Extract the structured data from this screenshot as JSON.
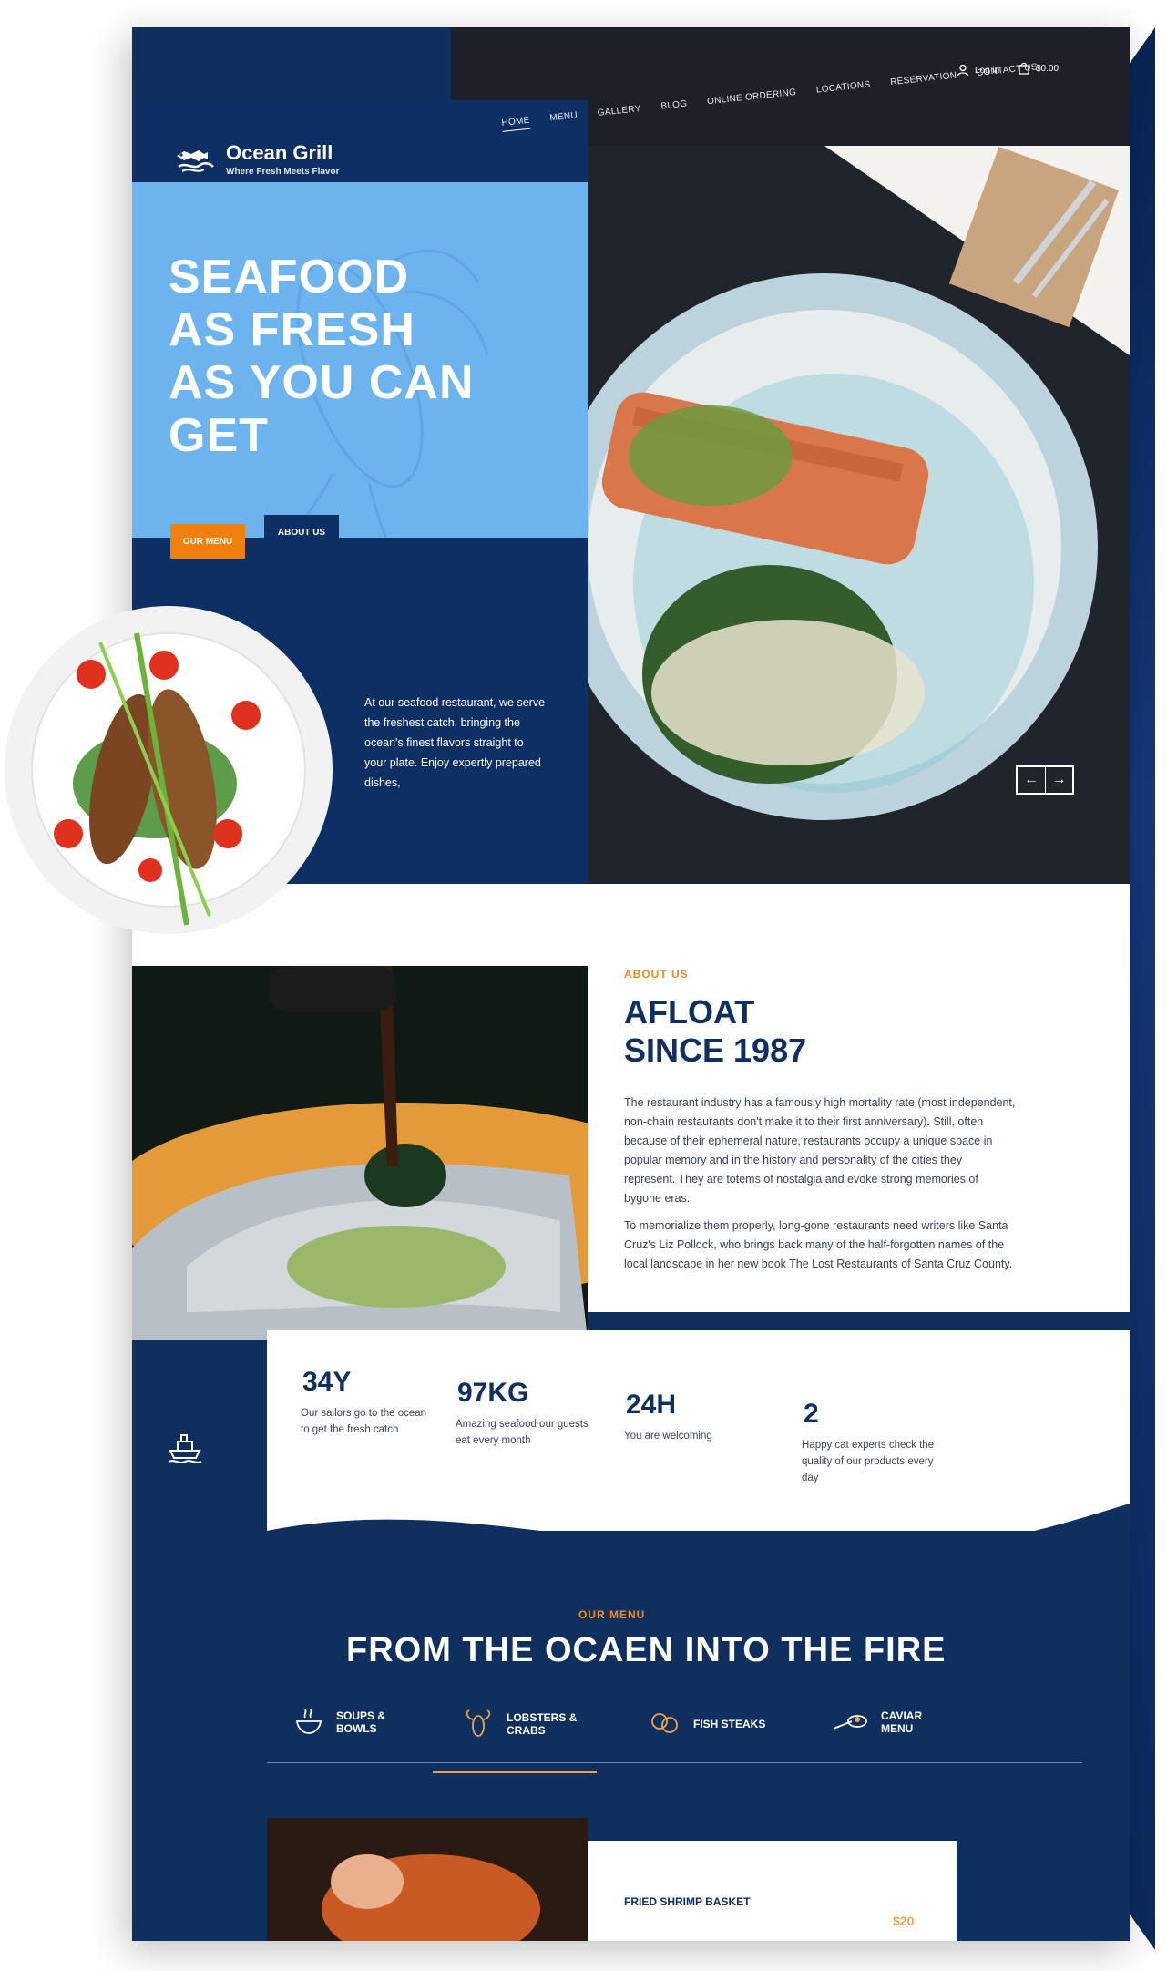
{
  "brand": {
    "name": "Ocean Grill",
    "tagline": "Where Fresh Meets Flavor"
  },
  "nav": {
    "items": [
      "HOME",
      "MENU",
      "GALLERY",
      "BLOG",
      "ONLINE ORDERING",
      "LOCATIONS",
      "RESERVATION",
      "CONTACT US"
    ],
    "login": "Log in",
    "cart": "$0.00"
  },
  "hero": {
    "title_lines": [
      "SEAFOOD",
      "AS FRESH",
      "AS YOU CAN",
      "GET"
    ],
    "btn_menu": "OUR MENU",
    "btn_about": "ABOUT US",
    "text": "At our seafood restaurant, we serve the freshest catch, bringing the ocean's finest flavors straight to your plate. Enjoy expertly prepared dishes,"
  },
  "about": {
    "eyebrow": "ABOUT US",
    "title_lines": [
      "AFLOAT",
      "SINCE 1987"
    ],
    "p1": "The restaurant industry has a famously high mortality rate (most independent, non-chain restaurants don't make it to their first anniversary). Still, often because of their ephemeral nature, restaurants occupy a unique space in popular memory and in the history and personality of the cities they represent. They are totems of nostalgia and evoke strong memories of bygone eras.",
    "p2": "To memorialize them properly, long-gone restaurants need writers like Santa Cruz's Liz Pollock, who brings back many of the half-forgotten names of the local landscape in her new book The Lost Restaurants of Santa Cruz County."
  },
  "stats": [
    {
      "value": "34Y",
      "desc": "Our sailors go to the ocean to get the fresh catch"
    },
    {
      "value": "97KG",
      "desc": "Amazing seafood our guests eat every month"
    },
    {
      "value": "24H",
      "desc": "You are welcoming"
    },
    {
      "value": "2",
      "desc": "Happy cat experts check the quality of our products every day"
    }
  ],
  "menu": {
    "eyebrow": "OUR MENU",
    "title": "FROM THE OCAEN INTO THE FIRE",
    "categories": [
      {
        "label": "SOUPS & BOWLS",
        "icon": "bowl-icon"
      },
      {
        "label": "LOBSTERS & CRABS",
        "icon": "lobster-icon"
      },
      {
        "label": "FISH STEAKS",
        "icon": "fish-steak-icon"
      },
      {
        "label": "CAVIAR MENU",
        "icon": "caviar-icon"
      }
    ],
    "card": {
      "title": "FRIED SHRIMP BASKET",
      "price": "$20"
    }
  },
  "colors": {
    "navy": "#0e2f63",
    "sky": "#6db3ee",
    "orange": "#f07f0e",
    "dark": "#1d2026"
  }
}
